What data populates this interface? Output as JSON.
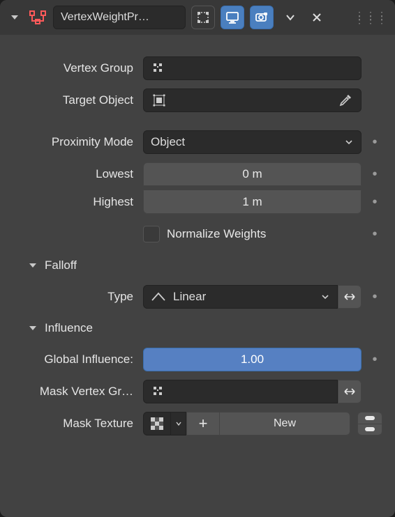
{
  "header": {
    "modifier_name": "VertexWeightPr…"
  },
  "vertex_group": {
    "label": "Vertex Group",
    "value": ""
  },
  "target_object": {
    "label": "Target Object",
    "value": ""
  },
  "proximity_mode": {
    "label": "Proximity Mode",
    "value": "Object"
  },
  "lowest": {
    "label": "Lowest",
    "value": "0 m"
  },
  "highest": {
    "label": "Highest",
    "value": "1 m"
  },
  "normalize": {
    "label": "Normalize Weights"
  },
  "falloff": {
    "heading": "Falloff",
    "type_label": "Type",
    "type_value": "Linear"
  },
  "influence": {
    "heading": "Influence",
    "global_label": "Global Influence:",
    "global_value": "1.00",
    "mask_vg_label": "Mask Vertex Gr…",
    "mask_vg_value": "",
    "mask_tex_label": "Mask Texture",
    "new_label": "New"
  }
}
